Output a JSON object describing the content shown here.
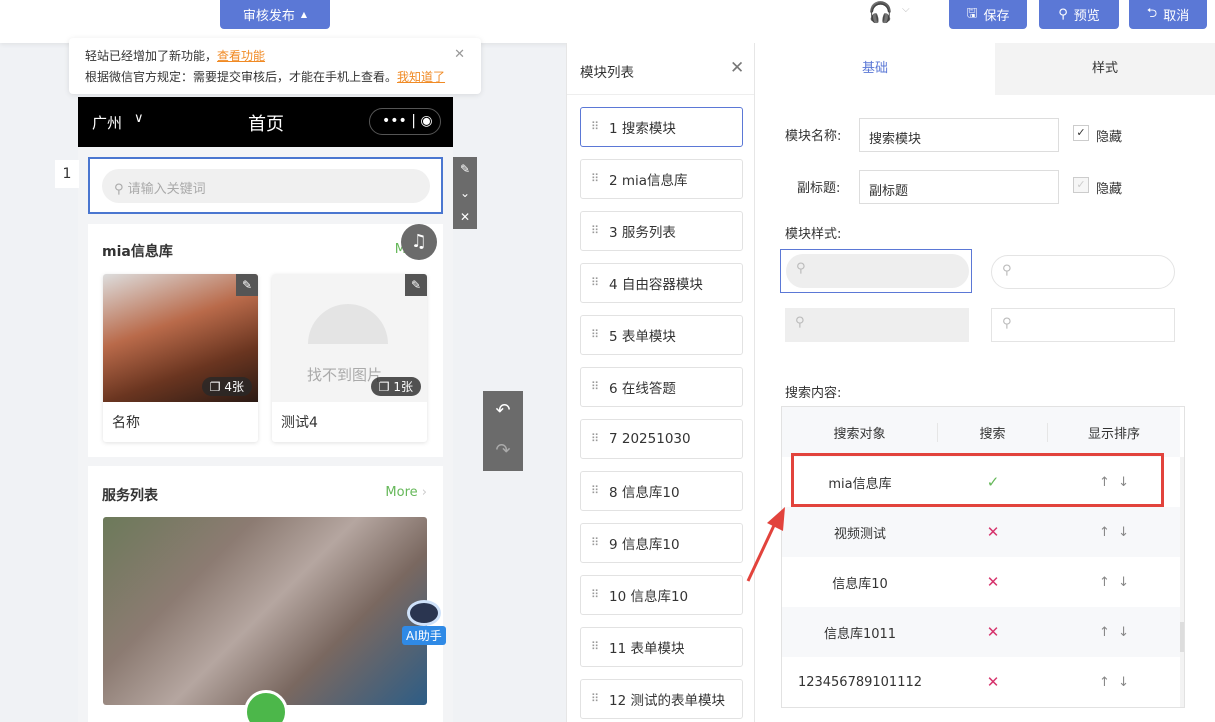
{
  "topbar": {
    "publish": "审核发布",
    "save": "保存",
    "preview": "预览",
    "cancel": "取消"
  },
  "notice": {
    "line1": "轻站已经增加了新功能，",
    "link1": "查看功能",
    "line2": "根据微信官方规定：需要提交审核后，才能在手机上查看。",
    "link2": "我知道了"
  },
  "phone": {
    "city": "广州",
    "title": "首页",
    "module_index": "1",
    "search_placeholder": "请输入关键词",
    "info": {
      "title": "mia信息库",
      "more": "More",
      "items": [
        {
          "name": "名称",
          "count": "4张"
        },
        {
          "name": "测试4",
          "count": "1张",
          "missing": "找不到图片"
        }
      ]
    },
    "service": {
      "title": "服务列表",
      "more": "More"
    },
    "ai": "AI助手"
  },
  "module_list": {
    "title": "模块列表",
    "items": [
      "1 搜索模块",
      "2 mia信息库",
      "3 服务列表",
      "4 自由容器模块",
      "5 表单模块",
      "6 在线答题",
      "7 20251030",
      "8 信息库10",
      "9 信息库10",
      "10 信息库10",
      "11 表单模块",
      "12 测试的表单模块"
    ]
  },
  "settings": {
    "tabs": [
      "基础",
      "样式"
    ],
    "name_label": "模块名称:",
    "name_value": "搜索模块",
    "hide": "隐藏",
    "subtitle_label": "副标题:",
    "subtitle_value": "副标题",
    "style_label": "模块样式:",
    "content_label": "搜索内容:",
    "table": {
      "headers": [
        "搜索对象",
        "搜索",
        "显示排序"
      ],
      "rows": [
        {
          "name": "mia信息库",
          "search": true
        },
        {
          "name": "视频测试",
          "search": false
        },
        {
          "name": "信息库10",
          "search": false
        },
        {
          "name": "信息库1011",
          "search": false
        },
        {
          "name": "123456789101112",
          "search": false
        }
      ]
    }
  },
  "colors": {
    "accent": "#5b78d6",
    "green": "#66b85a",
    "red": "#e2433c"
  }
}
